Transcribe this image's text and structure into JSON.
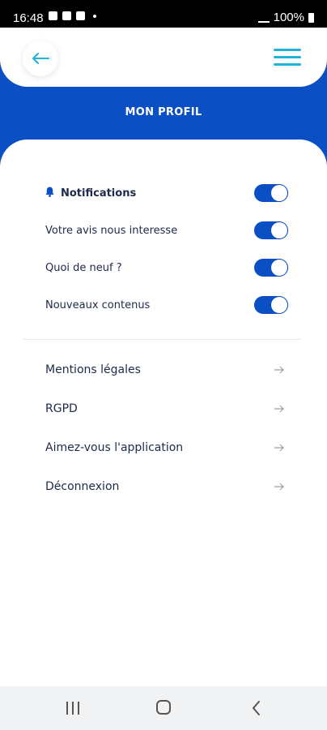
{
  "status_bar": {
    "time": "16:48",
    "battery": "100%"
  },
  "header": {
    "title": "MON PROFIL"
  },
  "notifications": [
    {
      "label": "Notifications",
      "enabled": true
    },
    {
      "label": "Votre avis nous interesse",
      "enabled": true
    },
    {
      "label": "Quoi de neuf ?",
      "enabled": true
    },
    {
      "label": "Nouveaux contenus",
      "enabled": true
    }
  ],
  "links": [
    {
      "label": "Mentions légales"
    },
    {
      "label": "RGPD"
    },
    {
      "label": "Aimez-vous l'application"
    },
    {
      "label": "Déconnexion"
    }
  ],
  "colors": {
    "brand_blue": "#0b4fc4",
    "accent_cyan": "#1fb3d9",
    "text": "#1f2a4a"
  },
  "icons": [
    "back-arrow-icon",
    "hamburger-menu-icon",
    "bell-icon",
    "chevron-right-arrow-icon"
  ]
}
